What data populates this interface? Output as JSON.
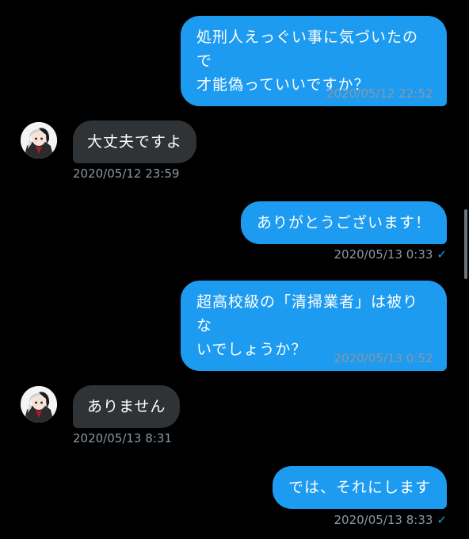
{
  "messages": [
    {
      "direction": "sent",
      "text": "処刑人えっぐい事に気づいたので\n才能偽っていいですか？",
      "timestamp": "2020/05/12 22:52",
      "status_icon": "checkmark-icon"
    },
    {
      "direction": "received",
      "text": "大丈夫ですよ",
      "timestamp": "2020/05/12 23:59",
      "avatar_icon": "anime-character-avatar"
    },
    {
      "direction": "sent",
      "text": "ありがとうございます！",
      "timestamp": "2020/05/13 0:33",
      "status_icon": "checkmark-icon"
    },
    {
      "direction": "sent",
      "text": "超高校級の「清掃業者」は被りな\nいでしょうか？",
      "timestamp": "2020/05/13 0:52",
      "status_icon": "checkmark-icon"
    },
    {
      "direction": "received",
      "text": "ありません",
      "timestamp": "2020/05/13 8:31",
      "avatar_icon": "anime-character-avatar"
    },
    {
      "direction": "sent",
      "text": "では、それにします",
      "timestamp": "2020/05/13 8:33",
      "status_icon": "checkmark-icon"
    }
  ],
  "check_mark": "✓",
  "colors": {
    "background": "#000000",
    "sent_bubble": "#1d9bf0",
    "received_bubble": "#2f3336",
    "timestamp": "#8b98a5",
    "text": "#ffffff"
  }
}
